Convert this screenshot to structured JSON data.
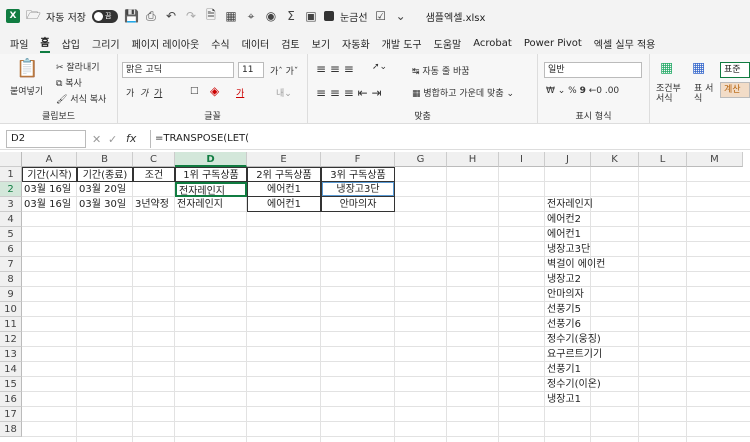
{
  "titlebar": {
    "autosave_label": "자동 저장",
    "toggle_state": "끔",
    "feature_label": "눈금선",
    "filename": "샘플엑셀.xlsx"
  },
  "menu": [
    "파일",
    "홈",
    "삽입",
    "그리기",
    "페이지 레이아웃",
    "수식",
    "데이터",
    "검토",
    "보기",
    "자동화",
    "개발 도구",
    "도움말",
    "Acrobat",
    "Power Pivot",
    "엑셀 실무 적용"
  ],
  "ribbon": {
    "clipboard": {
      "paste": "붙여넣기",
      "cut": "잘라내기",
      "copy": "복사",
      "format_painter": "서식 복사",
      "label": "클립보드"
    },
    "font": {
      "name": "맑은 고딕",
      "size": "11",
      "label": "글꼴"
    },
    "align": {
      "wrap": "자동 줄 바꿈",
      "merge": "병합하고 가운데 맞춤",
      "label": "맞춤"
    },
    "number": {
      "format": "일반",
      "label": "표시 형식"
    },
    "styles": {
      "cond": "조건부 서식",
      "table": "표 서식",
      "normal": "표준",
      "calc": "계산"
    }
  },
  "formula": {
    "namebox": "D2",
    "fx": "fx",
    "content": "=TRANSPOSE(LET("
  },
  "columns": [
    "A",
    "B",
    "C",
    "D",
    "E",
    "F",
    "G",
    "H",
    "I",
    "J",
    "K",
    "L",
    "M"
  ],
  "rows": [
    "1",
    "2",
    "3",
    "4",
    "5",
    "6",
    "7",
    "8",
    "9",
    "10",
    "11",
    "12",
    "13",
    "14",
    "15",
    "16",
    "17",
    "18"
  ],
  "cells": [
    {
      "r": 0,
      "c": 0,
      "t": "기간(시작)"
    },
    {
      "r": 0,
      "c": 1,
      "t": "기간(종료)"
    },
    {
      "r": 0,
      "c": 2,
      "t": "조건"
    },
    {
      "r": 0,
      "c": 3,
      "t": "1위 구독상품"
    },
    {
      "r": 0,
      "c": 4,
      "t": "2위 구독상품"
    },
    {
      "r": 0,
      "c": 5,
      "t": "3위 구독상품"
    },
    {
      "r": 1,
      "c": 0,
      "t": "03월 16일"
    },
    {
      "r": 1,
      "c": 1,
      "t": "03월 20일"
    },
    {
      "r": 1,
      "c": 3,
      "t": "전자레인지"
    },
    {
      "r": 1,
      "c": 4,
      "t": "에어컨1"
    },
    {
      "r": 1,
      "c": 5,
      "t": "냉장고3단"
    },
    {
      "r": 2,
      "c": 0,
      "t": "03월 16일"
    },
    {
      "r": 2,
      "c": 1,
      "t": "03월 30일"
    },
    {
      "r": 2,
      "c": 2,
      "t": "3년약정"
    },
    {
      "r": 2,
      "c": 3,
      "t": "전자레인지"
    },
    {
      "r": 2,
      "c": 4,
      "t": "에어컨1"
    },
    {
      "r": 2,
      "c": 5,
      "t": "안마의자"
    }
  ],
  "jlist": [
    "전자레인지",
    "에어컨2",
    "에어컨1",
    "냉장고3단",
    "벽걸이 에이컨",
    "냉장고2",
    "안마의자",
    "선풍기5",
    "선풍기6",
    "정수기(웅징)",
    "요구르트기기",
    "선풍기1",
    "정수기(이온)",
    "냉장고1"
  ]
}
